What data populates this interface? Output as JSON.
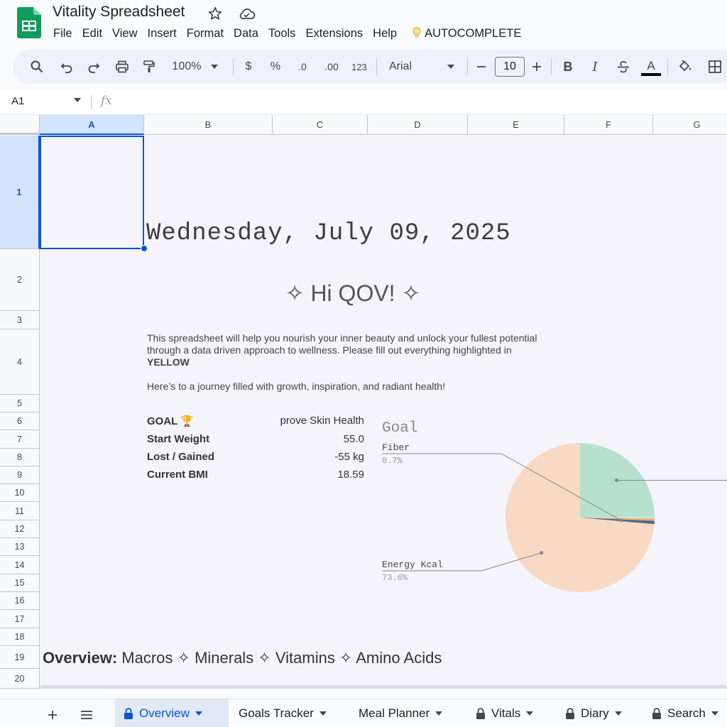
{
  "app": {
    "title": "Vitality Spreadsheet",
    "menu": [
      "File",
      "Edit",
      "View",
      "Insert",
      "Format",
      "Data",
      "Tools",
      "Extensions",
      "Help"
    ],
    "autocomplete_label": "AUTOCOMPLETE"
  },
  "toolbar": {
    "zoom": "100%",
    "currency": "$",
    "percent": "%",
    "decrease_decimal": ".0",
    "increase_decimal": ".00",
    "number_format": "123",
    "font": "Arial",
    "font_size": "10",
    "bold": "B",
    "italic": "I",
    "text_color": "A"
  },
  "formula_bar": {
    "cell_ref": "A1",
    "fx": "fx"
  },
  "grid": {
    "columns": [
      "A",
      "B",
      "C",
      "D",
      "E",
      "F",
      "G"
    ],
    "rows": [
      "1",
      "2",
      "3",
      "4",
      "5",
      "6",
      "7",
      "8",
      "9",
      "10",
      "11",
      "12",
      "13",
      "14",
      "15",
      "16",
      "17",
      "18",
      "19",
      "20"
    ]
  },
  "content": {
    "date": "Wednesday, July 09, 2025",
    "greeting": "✧ Hi QOV! ✧",
    "intro": "This spreadsheet will help you nourish your inner beauty and unlock your fullest potential through a data driven approach to wellness. Please fill out everything highlighted in",
    "intro_highlight": "YELLOW",
    "journey": "Here’s to a journey filled with growth, inspiration, and radiant health!",
    "stats": [
      {
        "label": "GOAL 🏆",
        "value": "prove Skin Health"
      },
      {
        "label": "Start Weight",
        "value": "55.0"
      },
      {
        "label": "Lost / Gained",
        "value": "-55 kg"
      },
      {
        "label": "Current BMI",
        "value": "18.59"
      }
    ],
    "overview_label": "Overview:",
    "overview_items": " Macros ✧ Minerals ✧ Vitamins ✧ Amino Acids"
  },
  "chart_data": {
    "type": "pie",
    "title": "Goal",
    "slices": [
      {
        "name": "Energy Kcal",
        "value": 73.6,
        "label": "73.6%",
        "color": "#f8d9c4"
      },
      {
        "name": "",
        "value": 24.7,
        "label": "",
        "color": "#b7e1cd"
      },
      {
        "name": "",
        "value": 0.5,
        "label": "",
        "color": "#c9e7df"
      },
      {
        "name": "",
        "value": 0.5,
        "label": "",
        "color": "#f6b26b"
      },
      {
        "name": "Fiber",
        "value": 0.7,
        "label": "0.7%",
        "color": "#4a6a8a"
      }
    ]
  },
  "sheets": [
    {
      "name": "Overview",
      "locked": true,
      "active": true
    },
    {
      "name": "Goals Tracker",
      "locked": false,
      "active": false
    },
    {
      "name": "Meal Planner",
      "locked": false,
      "active": false
    },
    {
      "name": "Vitals",
      "locked": true,
      "active": false
    },
    {
      "name": "Diary",
      "locked": true,
      "active": false
    },
    {
      "name": "Search",
      "locked": true,
      "active": false
    }
  ],
  "colors": {
    "accent": "#0b57d0",
    "sheet_bg": "#f6f4fb"
  }
}
